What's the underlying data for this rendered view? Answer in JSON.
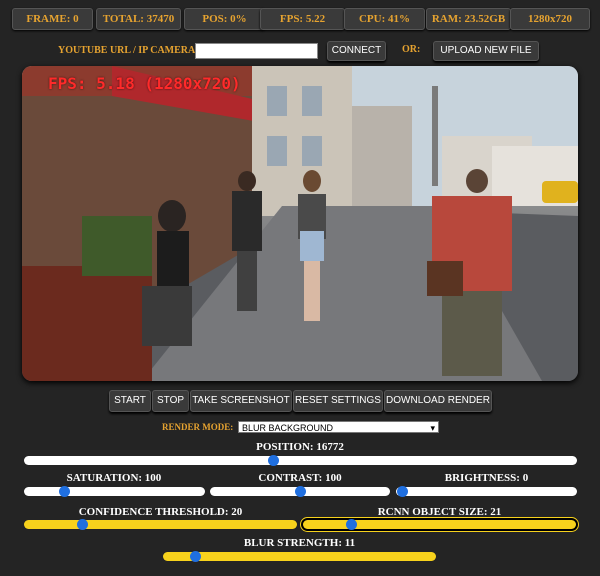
{
  "stats": {
    "frame": "FRAME: 0",
    "total": "TOTAL: 37470",
    "pos": "POS: 0%",
    "fps": "FPS: 5.22",
    "cpu": "CPU: 41%",
    "ram": "RAM: 23.52GB",
    "res": "1280x720"
  },
  "source": {
    "url_label": "YOUTUBE URL / IP CAMERA:",
    "url_value": "",
    "connect_label": "CONNECT",
    "or_label": "OR:",
    "upload_label": "UPLOAD NEW FILE"
  },
  "video": {
    "overlay_text": "FPS: 5.18 (1280x720)",
    "overlay_color": "#ff2a2a"
  },
  "controls": {
    "start": "START",
    "stop": "STOP",
    "screenshot": "TAKE SCREENSHOT",
    "reset": "RESET SETTINGS",
    "download": "DOWNLOAD RENDER"
  },
  "render_mode": {
    "label": "RENDER MODE:",
    "selected": "BLUR BACKGROUND"
  },
  "sliders": {
    "position": {
      "label": "POSITION: 16772",
      "value": 16772,
      "fraction": 0.45
    },
    "saturation": {
      "label": "SATURATION: 100",
      "value": 100,
      "fraction": 0.2
    },
    "contrast": {
      "label": "CONTRAST: 100",
      "value": 100,
      "fraction": 0.5
    },
    "brightness": {
      "label": "BRIGHTNESS: 0",
      "value": 0,
      "fraction": 0.0
    },
    "confidence": {
      "label": "CONFIDENCE THRESHOLD: 20",
      "value": 20,
      "fraction": 0.2
    },
    "rcnn_size": {
      "label": "RCNN OBJECT SIZE: 21",
      "value": 21,
      "fraction": 0.16
    },
    "blur": {
      "label": "BLUR STRENGTH: 11",
      "value": 11,
      "fraction": 0.1
    }
  },
  "colors": {
    "accent_orange": "#e6a330",
    "slider_yellow": "#f7d21c",
    "thumb_blue": "#1f6fe0"
  }
}
